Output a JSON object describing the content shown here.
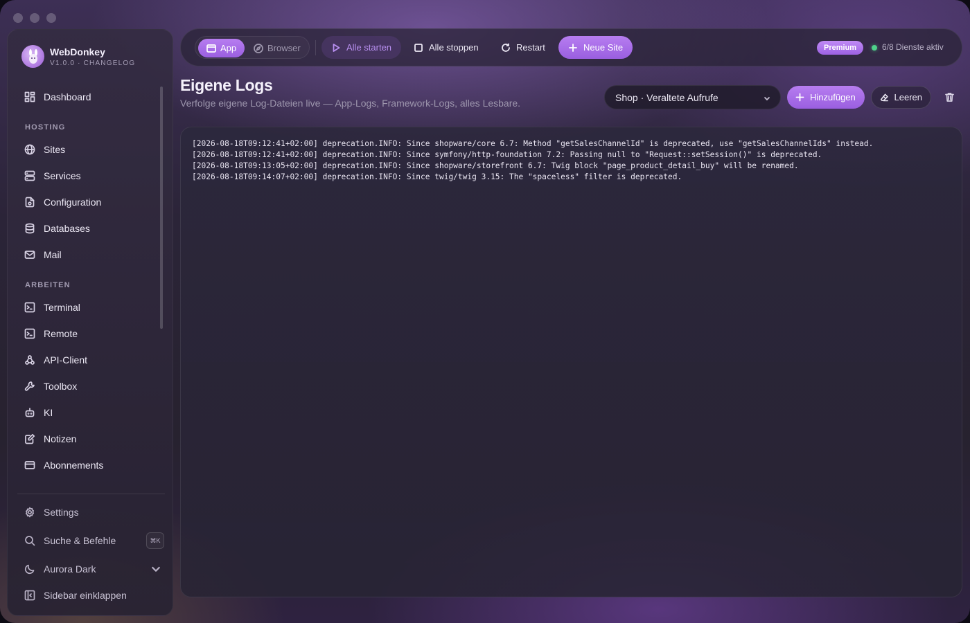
{
  "app": {
    "name": "WebDonkey",
    "version_line": "V1.0.0 · CHANGELOG"
  },
  "sidebar": {
    "top_items": [
      {
        "label": "Dashboard",
        "icon": "dashboard-icon"
      }
    ],
    "sections": [
      {
        "title": "HOSTING",
        "items": [
          {
            "label": "Sites",
            "icon": "globe-icon"
          },
          {
            "label": "Services",
            "icon": "server-icon"
          },
          {
            "label": "Configuration",
            "icon": "config-file-icon"
          },
          {
            "label": "Databases",
            "icon": "database-icon"
          },
          {
            "label": "Mail",
            "icon": "mail-icon"
          }
        ]
      },
      {
        "title": "ARBEITEN",
        "items": [
          {
            "label": "Terminal",
            "icon": "terminal-icon"
          },
          {
            "label": "Remote",
            "icon": "remote-terminal-icon"
          },
          {
            "label": "API-Client",
            "icon": "webhook-icon"
          },
          {
            "label": "Toolbox",
            "icon": "wrench-icon"
          },
          {
            "label": "KI",
            "icon": "bot-icon"
          },
          {
            "label": "Notizen",
            "icon": "notes-icon"
          },
          {
            "label": "Abonnements",
            "icon": "credit-card-icon"
          }
        ]
      }
    ],
    "bottom": {
      "settings": "Settings",
      "search": "Suche & Befehle",
      "search_shortcut": "⌘K",
      "theme": "Aurora Dark",
      "collapse": "Sidebar einklappen"
    }
  },
  "topbar": {
    "mode_app": "App",
    "mode_browser": "Browser",
    "start_all": "Alle starten",
    "stop_all": "Alle stoppen",
    "restart": "Restart",
    "new_site": "Neue Site",
    "badge": "Premium",
    "services_status": "6/8 Dienste aktiv"
  },
  "page": {
    "title": "Eigene Logs",
    "subtitle": "Verfolge eigene Log-Dateien live — App-Logs, Framework-Logs, alles Lesbare.",
    "selected_log": "Shop · Veraltete Aufrufe",
    "add_label": "Hinzufügen",
    "clear_label": "Leeren"
  },
  "log_lines": [
    "[2026-08-18T09:12:41+02:00] deprecation.INFO: Since shopware/core 6.7: Method \"getSalesChannelId\" is deprecated, use \"getSalesChannelIds\" instead.",
    "[2026-08-18T09:12:41+02:00] deprecation.INFO: Since symfony/http-foundation 7.2: Passing null to \"Request::setSession()\" is deprecated.",
    "[2026-08-18T09:13:05+02:00] deprecation.INFO: Since shopware/storefront 6.7: Twig block \"page_product_detail_buy\" will be renamed.",
    "[2026-08-18T09:14:07+02:00] deprecation.INFO: Since twig/twig 3.15: The \"spaceless\" filter is deprecated."
  ],
  "colors": {
    "accent": "#a86ee8",
    "status_ok": "#4ed18a"
  }
}
